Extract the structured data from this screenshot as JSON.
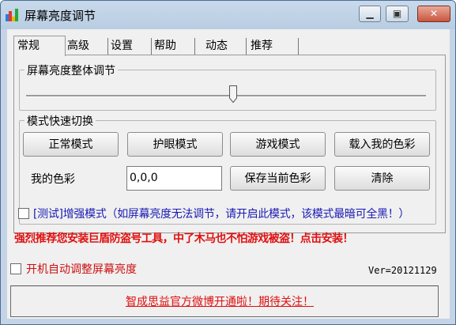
{
  "window": {
    "title": "屏幕亮度调节"
  },
  "colors": {
    "accent_red": "#e01010",
    "link_blue": "#1a1ab4"
  },
  "tabs": [
    {
      "label": "常规",
      "active": true
    },
    {
      "label": "高级"
    },
    {
      "label": "设置"
    },
    {
      "label": "帮助"
    },
    {
      "label": "动态"
    },
    {
      "label": "推荐"
    }
  ],
  "brightness_group": {
    "title": "屏幕亮度整体调节",
    "level_fraction": 0.5
  },
  "mode_group": {
    "title": "模式快速切换",
    "buttons": [
      "正常模式",
      "护眼模式",
      "游戏模式",
      "载入我的色彩"
    ],
    "my_color_label": "我的色彩",
    "my_color_value": "0,0,0",
    "save_button": "保存当前色彩",
    "clear_button": "清除"
  },
  "enhanced_mode": {
    "text": "[测试]增强模式（如屏幕亮度无法调节，请开启此模式，该模式最暗可全黑！）",
    "checked": false
  },
  "promo_text": "强烈推荐您安装巨盾防盗号工具，中了木马也不怕游戏被盗！点击安装！",
  "autostart": {
    "text": "开机自动调整屏幕亮度",
    "checked": false
  },
  "version": "Ver=20121129",
  "footer_link": "智成思益官方微博开通啦！期待关注！"
}
